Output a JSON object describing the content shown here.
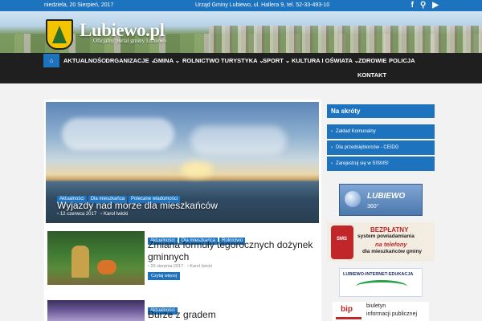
{
  "topbar": {
    "date": "niedziela, 20 Sierpień, 2017",
    "address": "Urząd Gminy Lubiewo, ul. Hallera 9, tel. 52-33-493-10",
    "social": [
      {
        "icon": "facebook-icon",
        "glyph": "f"
      },
      {
        "icon": "search-icon",
        "glyph": "⚲"
      },
      {
        "icon": "youtube-icon",
        "glyph": "▶"
      }
    ]
  },
  "header": {
    "site_name": "Lubiewo.pl",
    "tagline": "Oficjalny portal gminy Lubiewo"
  },
  "nav": {
    "home_glyph": "⌂",
    "items": [
      {
        "label": "AKTUALNOŚCI"
      },
      {
        "label": "ORGANIZACJE ⌄"
      },
      {
        "label": "GMINA ⌄"
      },
      {
        "label": "ROLNICTWO"
      },
      {
        "label": "TURYSTYKA ⌄"
      },
      {
        "label": "SPORT ⌄"
      },
      {
        "label": "KULTURA I OŚWIATA ⌄"
      },
      {
        "label": "ZDROWIE"
      },
      {
        "label": "POLICJA"
      },
      {
        "label": "KONTAKT"
      }
    ]
  },
  "featured": {
    "tags": [
      "Aktualności",
      "Dla mieszkańca",
      "Polecane wiadomości"
    ],
    "title": "Wyjazdy nad morze dla mieszkańców",
    "date": "12 czerwca 2017",
    "author": "Karol Iwicki"
  },
  "articles": [
    {
      "tags": [
        "Aktualności",
        "Dla mieszkańca",
        "Rolnictwo"
      ],
      "title": "Zmiana formuły tegorocznych dożynek gminnych",
      "date": "20 sierpnia 2017",
      "author": "Karol Iwicki",
      "more_label": "Czytaj więcej"
    },
    {
      "tags": [
        "Aktualności"
      ],
      "title": "Burze z gradem"
    }
  ],
  "sidebar": {
    "heading": "Na skróty",
    "links": [
      {
        "label": "Zakład Komunalny"
      },
      {
        "label": "Dla przedsiębiorców - CEIDG"
      },
      {
        "label": "Zarejestruj się w SISMS!"
      }
    ],
    "banner_360": {
      "name": "LUBIEWO",
      "suffix": "360°"
    },
    "promo": {
      "line1": "BEZPŁATNY",
      "line2": "system powiadamiania",
      "line3": "na telefony",
      "line4": "dla mieszkańców gminy",
      "phone_label": "SMS"
    },
    "edu_banner": "LUBIEWO-INTERNET-EDUKACJA",
    "bip": {
      "logo": "bip",
      "line1": "biuletyn",
      "line2": "informacji publicznej"
    }
  },
  "colors": {
    "accent": "#1e73be",
    "nav_bg": "#1f1f1f",
    "promo_red": "#c0262a"
  }
}
